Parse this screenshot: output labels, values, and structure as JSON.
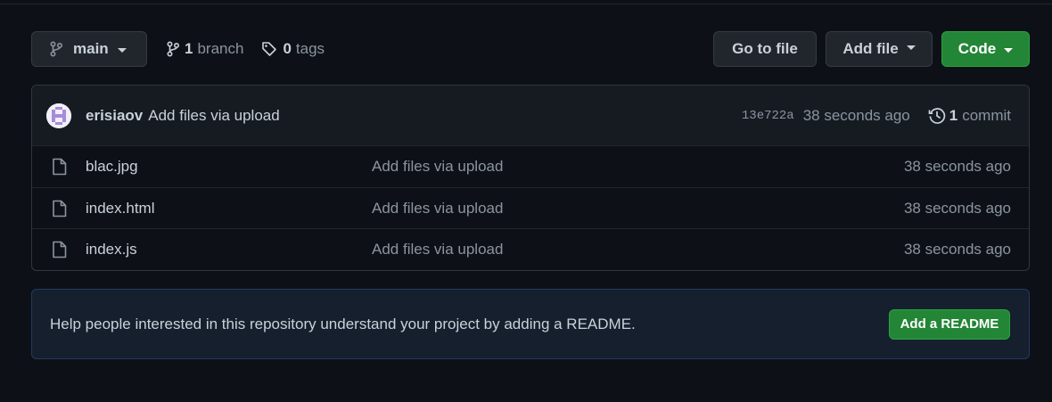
{
  "toolbar": {
    "branch_label": "main",
    "branch_count": "1",
    "branch_word": "branch",
    "tag_count": "0",
    "tag_word": "tags",
    "goto_label": "Go to file",
    "addfile_label": "Add file",
    "code_label": "Code"
  },
  "commit": {
    "author": "erisiaov",
    "message": "Add files via upload",
    "sha": "13e722a",
    "time": "38 seconds ago",
    "count": "1",
    "count_word": "commit"
  },
  "files": [
    {
      "name": "blac.jpg",
      "message": "Add files via upload",
      "age": "38 seconds ago"
    },
    {
      "name": "index.html",
      "message": "Add files via upload",
      "age": "38 seconds ago"
    },
    {
      "name": "index.js",
      "message": "Add files via upload",
      "age": "38 seconds ago"
    }
  ],
  "readme": {
    "text": "Help people interested in this repository understand your project by adding a README.",
    "button_label": "Add a README"
  },
  "colors": {
    "background": "#0d1117",
    "accent_green": "#238636",
    "readme_bg": "#161f2e"
  },
  "icons": [
    "branch-icon",
    "git-branch-icon",
    "tag-icon",
    "history-icon",
    "file-icon",
    "avatar-identicon"
  ]
}
